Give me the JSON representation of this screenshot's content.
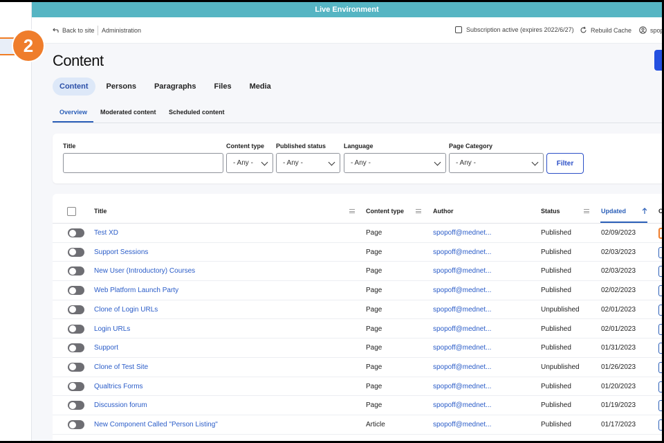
{
  "env_banner": "Live Environment",
  "step_badge": "2",
  "topnav": {
    "back_label": "Back to site",
    "admin_label": "Administration",
    "subscription_label": "Subscription active (expires 2022/6/27)",
    "rebuild_label": "Rebuild Cache",
    "user_label": "spop"
  },
  "page_title": "Content",
  "tabs": [
    "Content",
    "Persons",
    "Paragraphs",
    "Files",
    "Media"
  ],
  "subtabs": [
    "Overview",
    "Moderated content",
    "Scheduled content"
  ],
  "filters": {
    "title_label": "Title",
    "title_value": "",
    "content_type_label": "Content type",
    "content_type_value": "- Any -",
    "published_label": "Published status",
    "published_value": "- Any -",
    "language_label": "Language",
    "language_value": "- Any -",
    "page_category_label": "Page Category",
    "page_category_value": "- Any -",
    "filter_button": "Filter"
  },
  "table": {
    "headers": {
      "title": "Title",
      "content_type": "Content type",
      "author": "Author",
      "status": "Status",
      "updated": "Updated",
      "operations": "Op"
    },
    "rows": [
      {
        "title": "Test XD",
        "type": "Page",
        "author": "spopoff@mednet...",
        "status": "Published",
        "updated": "02/09/2023"
      },
      {
        "title": "Support Sessions",
        "type": "Page",
        "author": "spopoff@mednet...",
        "status": "Published",
        "updated": "02/03/2023"
      },
      {
        "title": "New User (Introductory) Courses",
        "type": "Page",
        "author": "spopoff@mednet...",
        "status": "Published",
        "updated": "02/03/2023"
      },
      {
        "title": "Web Platform Launch Party",
        "type": "Page",
        "author": "spopoff@mednet...",
        "status": "Published",
        "updated": "02/02/2023"
      },
      {
        "title": "Clone of Login URLs",
        "type": "Page",
        "author": "spopoff@mednet...",
        "status": "Unpublished",
        "updated": "02/01/2023"
      },
      {
        "title": "Login URLs",
        "type": "Page",
        "author": "spopoff@mednet...",
        "status": "Published",
        "updated": "02/01/2023"
      },
      {
        "title": "Support",
        "type": "Page",
        "author": "spopoff@mednet...",
        "status": "Published",
        "updated": "01/31/2023"
      },
      {
        "title": "Clone of Test Site",
        "type": "Page",
        "author": "spopoff@mednet...",
        "status": "Unpublished",
        "updated": "01/26/2023"
      },
      {
        "title": "Qualtrics Forms",
        "type": "Page",
        "author": "spopoff@mednet...",
        "status": "Published",
        "updated": "01/20/2023"
      },
      {
        "title": "Discussion forum",
        "type": "Page",
        "author": "spopoff@mednet...",
        "status": "Published",
        "updated": "01/19/2023"
      },
      {
        "title": "New Component Called \"Person Listing\"",
        "type": "Article",
        "author": "spopoff@mednet...",
        "status": "Published",
        "updated": "01/17/2023"
      }
    ]
  },
  "colors": {
    "env_banner": "#56b5c3",
    "accent": "#2b5fb8",
    "badge": "#ef7d2b",
    "primary_button": "#2450e0"
  }
}
